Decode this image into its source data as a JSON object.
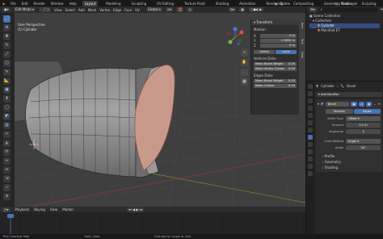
{
  "topbar": {
    "menus": [
      "File",
      "Edit",
      "Render",
      "Window",
      "Help"
    ],
    "workspaces": [
      "Layout",
      "Modeling",
      "Sculpting",
      "UV Editing",
      "Texture Paint",
      "Shading",
      "Animation",
      "Rendering",
      "Compositing",
      "Geometry Nodes",
      "Scripting"
    ],
    "scene": "Scene",
    "viewlayer": "ViewLayer"
  },
  "header": {
    "mode": "Edit Mode",
    "menus": [
      "View",
      "Select",
      "Add",
      "Mesh",
      "Vertex",
      "Edge",
      "Face",
      "UV"
    ],
    "orientation": "Global"
  },
  "viewport": {
    "view_name": "User Perspective",
    "object_name": "(1) Cylinder"
  },
  "npanel": {
    "title": "Transform",
    "median_label": "Median:",
    "x_label": "X",
    "x_value": "0 m",
    "y_label": "Y",
    "y_value": "1.9692 m",
    "z_label": "Z",
    "z_value": "0 m",
    "global_btn": "Global",
    "local_btn": "Local",
    "vertices_data_label": "Vertices Data:",
    "mean_bevel_weight": "Mean Bevel Weight",
    "mean_vertex_crease": "Mean Vertex Crease",
    "vert_val1": "0.00",
    "vert_val2": "0.00",
    "edges_data_label": "Edges Data:",
    "edge_bevel": "Mean Bevel Weight",
    "edge_crease": "Mean Crease",
    "edge_val1": "0.00",
    "edge_val2": "0.00"
  },
  "npanel_tabs": [
    "Item",
    "Tool",
    "View"
  ],
  "timeline": {
    "playback": "Playback",
    "keying": "Keying",
    "view": "View",
    "marker": "Marker"
  },
  "statusbar": {
    "s1": "Pick Shortest Path",
    "s2": "Dolly View",
    "s3": "Extrude to Cursor or Add"
  },
  "outliner": {
    "title": "Scene Collection",
    "items": [
      "Collection",
      "Cylinder",
      "Manifold ET"
    ]
  },
  "props": {
    "breadcrumb_object": "Cylinder",
    "breadcrumb_mod": "Bevel",
    "add_modifier": "Add Modifier",
    "mod_name": "Bevel",
    "vertices_btn": "Vertices",
    "edges_btn": "Edges",
    "width_type_label": "Width Type",
    "width_type": "Offset",
    "amount_label": "Amount",
    "amount": "0.1 m",
    "segments_label": "Segments",
    "segments": "3",
    "limit_label": "Limit Method",
    "limit": "Angle",
    "angle_label": "Angle",
    "angle": "30°",
    "sections": [
      "Profile",
      "Geometry",
      "Shading"
    ]
  },
  "colors": {
    "accent": "#4772b3",
    "background": "#3f3f3f",
    "cap_face": "#c8998a"
  }
}
